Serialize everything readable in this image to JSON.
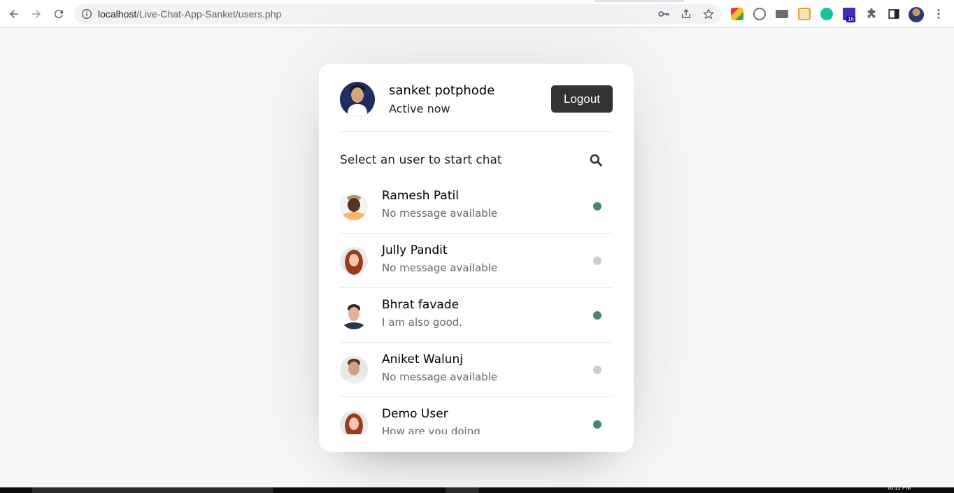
{
  "browser": {
    "url_host": "localhost",
    "url_path": "/Live-Chat-App-Sanket/users.php",
    "extension_badge": "16"
  },
  "taskbar": {
    "time": "10:11 PM"
  },
  "card": {
    "current_user": {
      "name": "sanket potphode",
      "status": "Active now"
    },
    "logout_label": "Logout",
    "search_prompt": "Select an user to start chat",
    "users": [
      {
        "name": "Ramesh Patil",
        "message": "No message available",
        "online": true
      },
      {
        "name": "Jully Pandit",
        "message": "No message available",
        "online": false
      },
      {
        "name": "Bhrat favade",
        "message": "I am also good.",
        "online": true
      },
      {
        "name": "Aniket Walunj",
        "message": "No message available",
        "online": false
      },
      {
        "name": "Demo User",
        "message": "How are you doing",
        "online": true
      }
    ],
    "colors": {
      "online": "#468669",
      "offline": "#cccccc",
      "button": "#333333"
    }
  }
}
